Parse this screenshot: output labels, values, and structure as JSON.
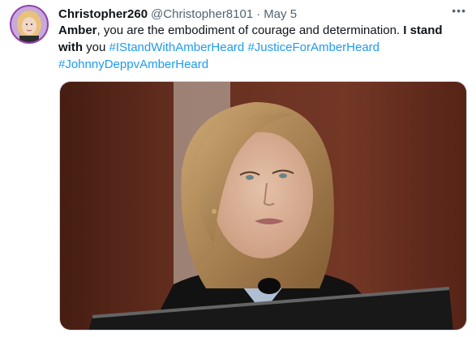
{
  "tweet": {
    "author": {
      "display_name": "Christopher260",
      "handle": "@Christopher8101",
      "avatar_icon": "profile-photo-icon"
    },
    "separator": "·",
    "date": "May 5",
    "more_icon": "more-horizontal-icon",
    "more_label": "•••",
    "text": {
      "part1_bold": "Amber",
      "part2": ", you are the embodiment of courage and determination. ",
      "part3_bold": "I stand with",
      "part4": " you ",
      "hashtag1": "#IStandWithAmberHeard",
      "hashtag2": "#JusticeForAmberHeard",
      "hashtag3": "#JohnnyDeppvAmberHeard"
    },
    "media": {
      "kind": "photo",
      "description_icon": "photo-woman-testifying"
    }
  },
  "colors": {
    "link": "#1d9bf0",
    "secondary_text": "#536471",
    "primary_text": "#0f1419",
    "avatar_ring": "#8e44ad"
  }
}
